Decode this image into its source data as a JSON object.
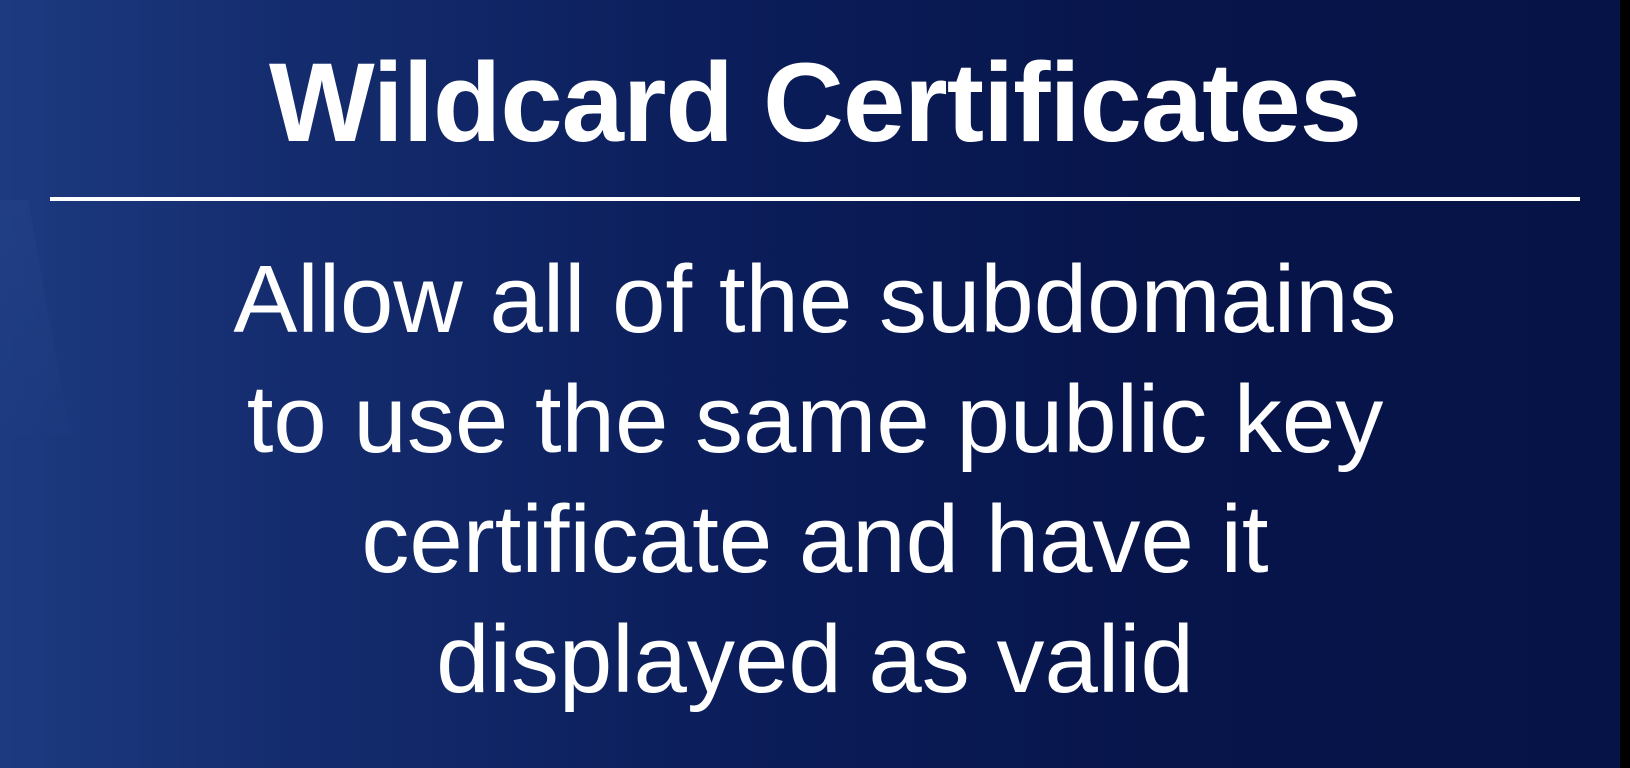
{
  "slide": {
    "title": "Wildcard Certificates",
    "body_lines": [
      "Allow all of the subdomains",
      "to use the same public key",
      "certificate and have it",
      "displayed as valid"
    ]
  },
  "colors": {
    "background_left": "#1d3a80",
    "background_right": "#061346",
    "text": "#ffffff",
    "divider": "#ffffff"
  }
}
